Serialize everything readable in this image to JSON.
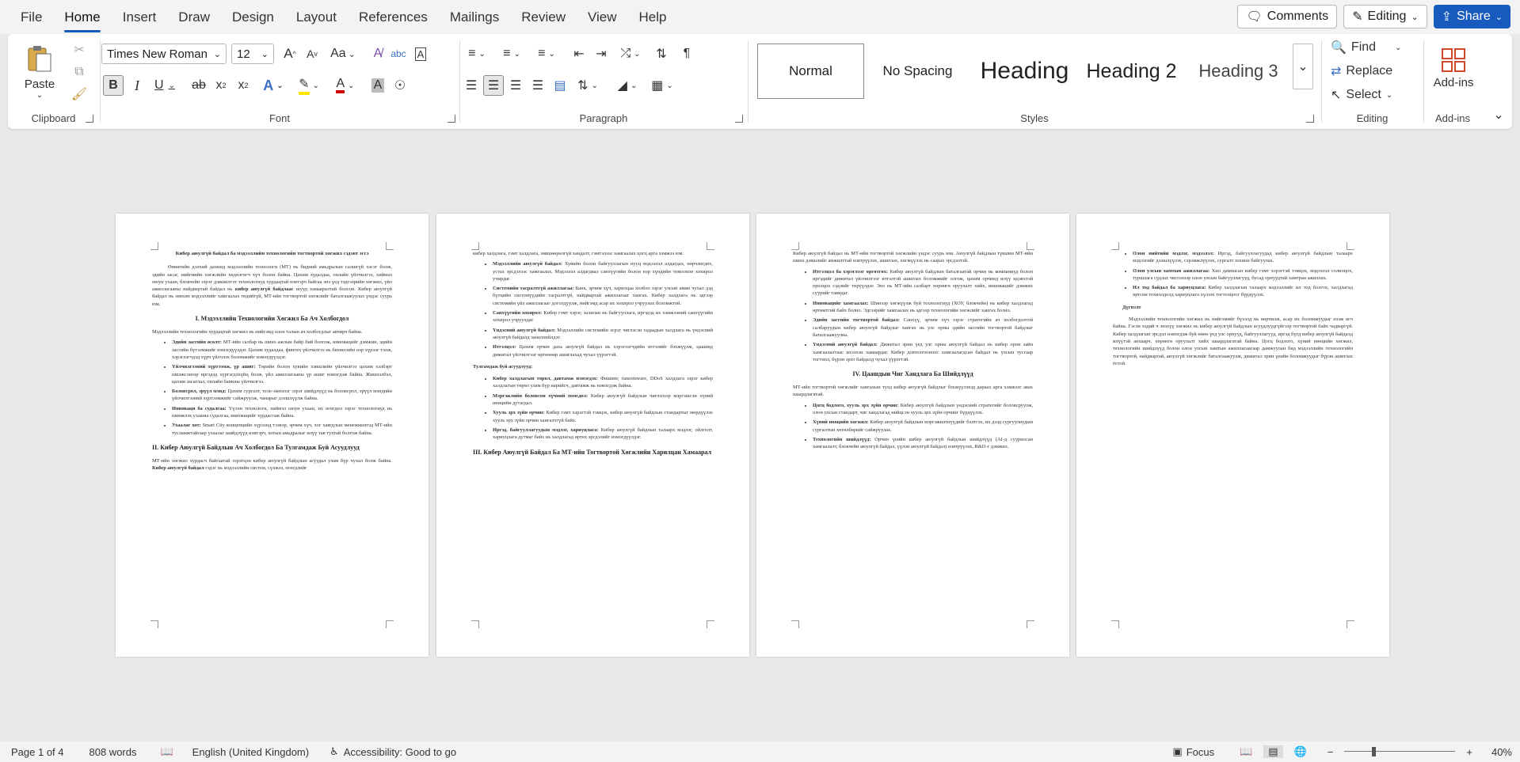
{
  "menu": [
    "File",
    "Home",
    "Insert",
    "Draw",
    "Design",
    "Layout",
    "References",
    "Mailings",
    "Review",
    "View",
    "Help"
  ],
  "active_menu": "Home",
  "top_right": {
    "comments": "Comments",
    "editing": "Editing",
    "share": "Share"
  },
  "ribbon": {
    "clipboard": {
      "paste": "Paste",
      "label": "Clipboard"
    },
    "font": {
      "name": "Times New Roman",
      "size": "12",
      "case": "Aa",
      "label": "Font"
    },
    "paragraph": {
      "label": "Paragraph"
    },
    "styles": {
      "items": [
        "Normal",
        "No Spacing",
        "Heading",
        "Heading 2",
        "Heading 3"
      ],
      "label": "Styles"
    },
    "editing": {
      "find": "Find",
      "replace": "Replace",
      "select": "Select",
      "label": "Editing"
    },
    "addins": {
      "button": "Add-ins",
      "label": "Add-ins"
    }
  },
  "pages": [
    {
      "title": "Кибер аюулгүй байдал ба мэдээллийн технологийн тогтвортой хөгжил сэдэвт эссэ",
      "intro_a": "Өнөөгийн дэлхий дахинд мэдээллийн технологи (МТ) нь бидний амьдралын салшгүй хэсэг болж, эдийн засаг, нийгмийн хөгжлийн хөдөлгөгч хүч болон байна. Цахим худалдаа, онлайн үйлчилгээ, хиймэл оюун ухаан, блокчейн зэрэг дэвшилтэт технологиуд хурдацтай нэвтэрч байгаа энэ үед тэдгээрийн хөгжил, үйл ажиллагааны найдвартай байдал нь",
      "intro_bold": "кибер аюулгүй байдлаас",
      "intro_b": "шууд хамааралтай болсон. Кибер аюулгүй байдал нь зөвхөн мэдээллийг хамгаалах төдийгүй, МТ-ийн тогтвортой хөгжлийг баталгаажуулах үндэс суурь юм.",
      "h1": "I. Мэдээллийн Технологийн Хөгжил Ба Ач Холбогдол",
      "p1": "Мэдээллийн технологийн хурдацтай хөгжил нь нийгэмд олон талын ач холбогдлыг авчирч байна.",
      "bullets": [
        {
          "b": "Эдийн засгийн өсөлт:",
          "t": "МТ-ийн салбар нь шинэ ажлын байр бий болгож, инновацийг дэмжин, эдийн засгийн бүтээмжийг нэмэгдүүлдэг. Цахим худалдаа, финтех үйлчилгээ нь бизнесийн нэр хүрээг тэлж, хэрэглэгчдэд хүрч үйлчлэх боломжийг нэмэгдүүлдэг."
        },
        {
          "b": "Үйлчилгээний хүртээмж, үр ашиг:",
          "t": "Төрийн болон хувийн хэвшлийн үйлчилгээ цахим хэлбэрт шилжсэнээр иргэдэд хүргэгдэхүйц болж, үйл ажиллагааны үр ашиг нэмэгдэж байна. Жишээлбэл, цахим засаглал, онлайн банкны үйлчилгээ."
        },
        {
          "b": "Боловсрол, эрүүл мэнд:",
          "t": "Цахим сургалт, теле-эмнэлэг зэрэг шийдлүүд нь боловсрол, эрүүл мэндийн үйлчилгээний хүртээмжийг сайжруулж, чанарыг дээшлүүлж байна."
        },
        {
          "b": "Инноваци ба судалгаа:",
          "t": "Үүлэн технологи, хиймэл оюун ухаан, их өгөгдөл зэрэг технологиуд нь шинжлэх ухааны судалгаа, инновацийг хурдасгаж байна."
        },
        {
          "b": "Ухаалаг хот:",
          "t": "Smart City концепцийн хүрээнд тээвэр, эрчим хүч, хог хаягдлын менежментэд МТ-ийн тусламжтайгаар ухаалаг шийдлүүд нэвтэрч, хотын амьдралыг илүү тав тухтай болгож байна."
        }
      ],
      "h2": "II. Кибер Аюулгүй Байдлын Ач Холбогдол Ба Тулгамдаж Буй Асуудлууд",
      "p2a": "МТ-ийн хөгжил хурдасч байгаатай зэрэгцэн кибер аюулгүй байдлын асуудал улам бүр чухал болж байна.",
      "p2bold": "Кибер аюулгүй байдал",
      "p2b": "гэдэг нь мэдээллийн систем, сүлжээ, өгөгдлийг"
    },
    {
      "p1": "кибер халдлага, гэмт халдлага, зөвшөөрөлгүй хандалт, гэмтэлээс хамгаалах цогц арга хэмжээ юм.",
      "bullets1": [
        {
          "b": "Мэдээллийн аюулгүй байдал:",
          "t": "Хувийн болон байгууллагын нууц мэдээлэл алдагдах, өөрчлөгдөх, устах эрсдэлээс хамгаалах. Мэдээлэл алдагдвал санхүүгийн болон нэр хүндийн томоохон хохирол учирдаг."
        },
        {
          "b": "Системийн тасралтгүй ажиллагаа:",
          "t": "Банк, эрчим хүч, харилцаа холбоо зэрэг улсын амин чухал дэд бүтцийн системүүдийн тасралтгүй, найдвартай ажиллагааг хангах. Кибер халдлага нь эдгээр системийн үйл ажиллагааг доголдуулж, нийгэмд асар их хохирол учруулах боломжтой."
        },
        {
          "b": "Санхүүгийн хохирол:",
          "t": "Кибер гэмт хэрэг, залилан нь байгууллага, иргэдэд их хэмжээний санхүүгийн хохирол учруулдаг."
        },
        {
          "b": "Үндэсний аюулгүй байдал:",
          "t": "Мэдээллийн системийн эсрэг чиглэсэн гадаадын халдлага нь үндэсний аюулгүй байдалд заналхийлдэг."
        },
        {
          "b": "Итгэлцэл:",
          "t": "Цахим орчин дахь аюулгүй байдал нь хэрэглэгчдийн итгэлийг бэхжүүлж, цаашид дижитал үйлчилгээг өргөнөөр ашиглахад чухал үүрэгтэй."
        }
      ],
      "sub": "Тулгамдаж буй асуудлууд:",
      "bullets2": [
        {
          "b": "Кибер халдлагын төрөл, давтамж нэмэгдэх:",
          "t": "Фишинг, ransomware, DDoS халдлага зэрэг кибер халдлагын төрөл улам бүр нарийсч, давтамж нь нэмэгдэж байна."
        },
        {
          "b": "Мэргэжлийн боловсон хүчний хомсдол:",
          "t": "Кибер аюулгүй байдлын чиглэлээр мэргэшсэн хүний нөөцийн дутагдал."
        },
        {
          "b": "Хууль эрх зүйн орчин:",
          "t": "Кибер гэмт хэрэгтэй тэмцэх, кибер аюулгүй байдлын стандартыг мөрдүүлэх хууль эрх зүйн орчин хангалтгүй байх."
        },
        {
          "b": "Иргэд, байгууллагуудын мэдлэг, хариуцлага:",
          "t": "Кибер аюулгүй байдлын талаарх мэдлэг, ойлголт, хариуцлага дутмаг байх нь халдлагад өртөх эрсдэлийг нэмэгдүүлдэг."
        }
      ],
      "h3": "III. Кибер Аюулгүй Байдал Ба МТ-ийн Тогтвортой Хөгжлийн Харилцан Хамаарал"
    },
    {
      "p1": "Кибер аюулгүй байдал нь МТ-ийн тогтвортой хөгжлийн үндэс суурь юм. Аюулгүй байдлын түвшин МТ-ийн шинэ дэвшлийг амжилттай нэвтрүүлэх, ашиглах, хөгжүүлэх нь саарах эрсдэлтэй.",
      "bullets1": [
        {
          "b": "Итгэлцэл ба хэрэглээг өргөтгөх:",
          "t": "Кибер аюулгүй байдлын баталгаатай орчин нь компаниуд болон иргэдийг дижитал үйлчилгээг итгэлтэй ашиглах боломжийг олгож, цахим орчинд илүү идэвхтэй оролцох сэдлийг төрүүлдэг. Энэ нь МТ-ийн салбарт хөрөнгө оруулалт хийх, инновацийг дэмжих суурийг тавидаг."
        },
        {
          "b": "Инновацийг хамгаалах:",
          "t": "Шинээр хөгжүүлж буй технологиуд (ХОУ, блокчейн) нь кибер халдлагад өртөмтгий байх болно. Эдгээрийг хамгаалах нь эдгээр технологийн хөгжлийг хангах болно."
        },
        {
          "b": "Эдийн засгийн тогтвортой байдал:",
          "t": "Санхүү, эрчим хүч зэрэг стратегийн ач холбогдолтой салбаруудын кибер аюулгүй байдлыг хангах нь улс орны эдийн засгийн тогтвортой байдлыг баталгаажуулна."
        },
        {
          "b": "Үндэсний аюулгүй байдал:",
          "t": "Дижитал эрин үед улс орны аюулгүй байдал нь кибер орон зайн хамгаалалтаас ихээхэн хамаардаг. Кибер довтолгооноос хамгаалагдсан байдал нь улсын тусгаар тогтнол, бүрэн эрхт байдалд чухал үүрэгтэй."
        }
      ],
      "h4": "IV. Цаашдын Чиг Хандлага Ба Шийдлүүд",
      "p2": "МТ-ийн тогтвортой хөгжлийг хангахын тулд кибер аюулгүй байдлыг бэхжүүлэхэд дараах арга хэмжээг авах шаардлагатай.",
      "bullets2": [
        {
          "b": "Цогц бодлого, хууль эрх зүйн орчин:",
          "t": "Кибер аюулгүй байдлын үндэсний стратегийг боловсруулж, олон улсын стандарт, чиг хандлагад нийцсэн хууль эрх зүйн орчинг бүрдүүлэх."
        },
        {
          "b": "Хүний нөөцийн хөгжил:",
          "t": "Кибер аюулгүй байдлын мэргэжилтнүүдийг бэлтгэх, их дээд сургуулиудын сургалтын хөтөлбөрийг сайжруулах."
        },
        {
          "b": "Технологийн шийдлүүд:",
          "t": "Орчин үеийн кибер аюулгүй байдлын шийдлүүд (AI-д суурилсан хамгаалалт, блокчейн аюулгүй байдал, үүлэн аюулгүй байдал) нэвтрүүлэх, R&D-г дэмжих."
        }
      ]
    },
    {
      "bullets": [
        {
          "b": "Олон нийтийн мэдлэг, мэдээлэл:",
          "t": "Иргэд, байгууллагуудад кибер аюулгүй байдлын талаарх мэдлэгийг дээшлүүлэх, сэрэмжлүүлэх, сургалт зохион байгуулах."
        },
        {
          "b": "Олон улсын хамтын ажиллагаа:",
          "t": "Хил дамнасан кибер гэмт хэрэгтэй тэмцэх, мэдээлэл солилцох, туршлага судлах чиглэлээр олон улсын байгууллагууд, бусад орнуудтай хамтран ажиллах."
        },
        {
          "b": "Ил тод байдал ба хариуцлага:",
          "t": "Кибер халдлагын талаарх мэдээллийг ил тод болгох, халдлагад өртсөн тохиолдолд хариуцлага хүлээх тогтолцоог бүрдүүлэх."
        }
      ],
      "sub": "Дүгнэлт",
      "p1": "Мэдээллийн технологийн хөгжил нь нийгэмийг бүхэлд нь өөрчилж, асар их боломжуудыг нээж өгч байна. Гэсэн хэдий ч энэхүү хөгжил нь кибер аюулгүй байдлын асуудлуудгүйгээр тогтвортой байх чадваргүй. Кибер халдлагын эрсдэл нэмэгдэж буй өнөө үед улс орнууд, байгууллагууд, иргэд бүгд кибер аюулгүй байдалд илүүтэй анхаарч, хөрөнгө оруулалт хийх шаардлагатай байна. Цогц бодлого, хүний нөөцийн хөгжил, технологийн шийдлүүд болон олон улсын хамтын ажиллагаагаар дамжуулан бид мэдээллийн технологийн тогтвортой, найдвартай, аюулгүй хөгжлийг баталгаажуулж, дижитал эрин үеийн боломжуудыг бүрэн ашиглах ёстой."
    }
  ],
  "status": {
    "page": "Page 1 of 4",
    "words": "808 words",
    "language": "English (United Kingdom)",
    "accessibility": "Accessibility: Good to go",
    "focus": "Focus",
    "zoom": "40%"
  }
}
